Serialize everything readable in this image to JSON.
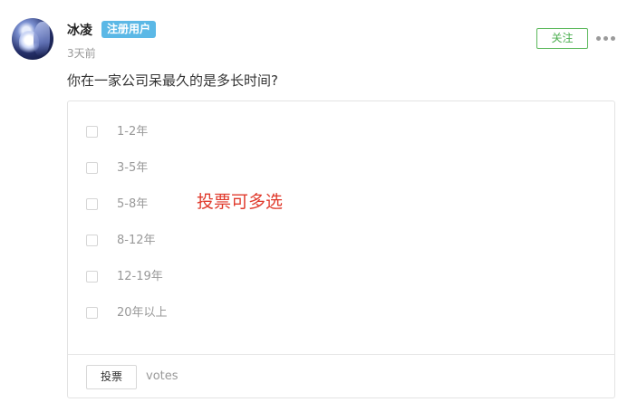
{
  "post": {
    "username": "冰凌",
    "badge": "注册用户",
    "time_ago": "3天前",
    "follow_label": "关注",
    "more_icon": "more-horizontal-icon",
    "question": "你在一家公司呆最久的是多长时间?"
  },
  "poll": {
    "options": [
      {
        "label": "1-2年",
        "checked": false
      },
      {
        "label": "3-5年",
        "checked": false
      },
      {
        "label": "5-8年",
        "checked": false
      },
      {
        "label": "8-12年",
        "checked": false
      },
      {
        "label": "12-19年",
        "checked": false
      },
      {
        "label": "20年以上",
        "checked": false
      }
    ],
    "multi_select_note": "投票可多选",
    "vote_button_label": "投票",
    "votes_label": "votes"
  },
  "colors": {
    "badge_bg": "#5bb8e6",
    "follow_accent": "#4caf50",
    "note_red": "#e03a2c"
  }
}
